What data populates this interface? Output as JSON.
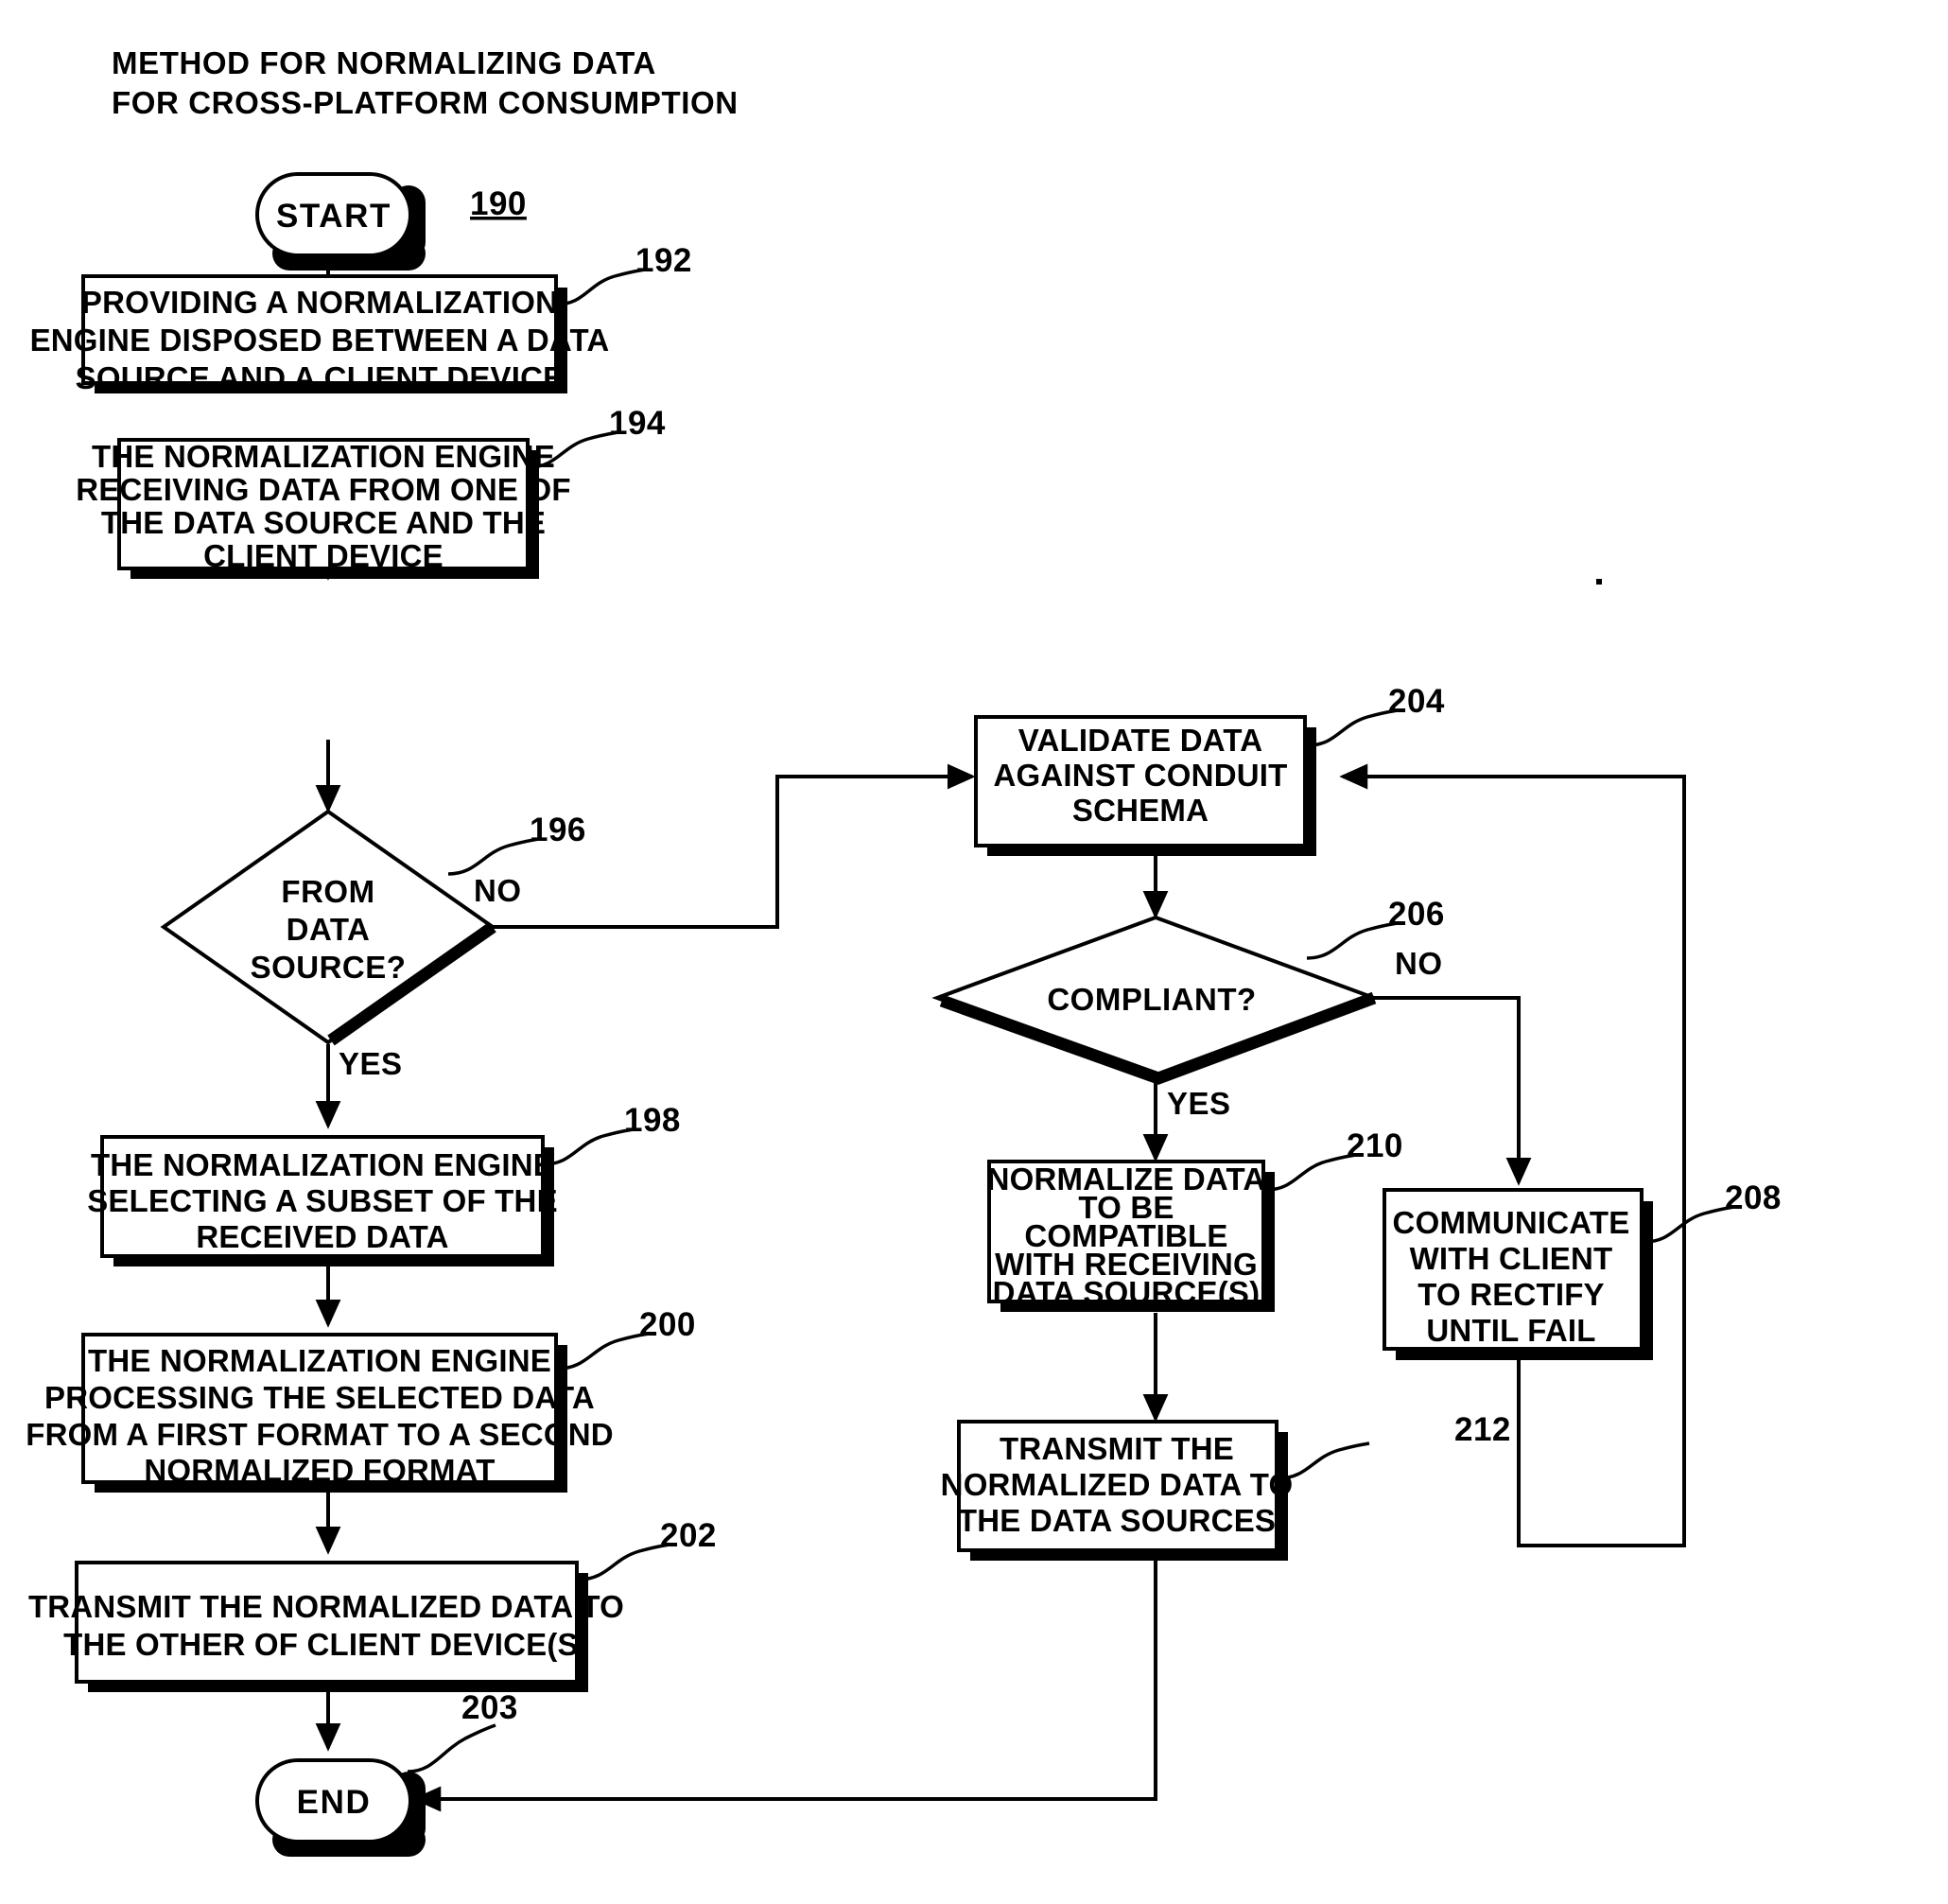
{
  "figure": {
    "title_line1": "METHOD FOR NORMALIZING DATA",
    "title_line2": "FOR CROSS-PLATFORM CONSUMPTION",
    "figure_ref": "190"
  },
  "terminals": {
    "start": "START",
    "end": "END",
    "end_ref": "203"
  },
  "nodes": {
    "n192": {
      "ref": "192",
      "lines": [
        "PROVIDING A NORMALIZATION",
        "ENGINE DISPOSED BETWEEN A DATA",
        "SOURCE AND A CLIENT DEVICE"
      ]
    },
    "n194": {
      "ref": "194",
      "lines": [
        "THE NORMALIZATION ENGINE",
        "RECEIVING DATA FROM ONE OF",
        "THE DATA SOURCE AND THE",
        "CLIENT DEVICE"
      ]
    },
    "n196": {
      "ref": "196",
      "lines": [
        "FROM",
        "DATA",
        "SOURCE?"
      ],
      "yes_label": "YES",
      "no_label": "NO"
    },
    "n198": {
      "ref": "198",
      "lines": [
        "THE NORMALIZATION ENGINE",
        "SELECTING A SUBSET OF THE",
        "RECEIVED DATA"
      ]
    },
    "n200": {
      "ref": "200",
      "lines": [
        "THE NORMALIZATION ENGINE",
        "PROCESSING THE SELECTED DATA",
        "FROM A FIRST FORMAT TO A SECOND",
        "NORMALIZED FORMAT"
      ]
    },
    "n202": {
      "ref": "202",
      "lines": [
        "TRANSMIT THE NORMALIZED DATA TO",
        "THE OTHER OF CLIENT DEVICE(S)"
      ]
    },
    "n204": {
      "ref": "204",
      "lines": [
        "VALIDATE DATA",
        "AGAINST CONDUIT",
        "SCHEMA"
      ]
    },
    "n206": {
      "ref": "206",
      "lines": [
        "COMPLIANT?"
      ],
      "yes_label": "YES",
      "no_label": "NO"
    },
    "n208": {
      "ref": "208",
      "lines": [
        "COMMUNICATE",
        "WITH CLIENT",
        "TO RECTIFY",
        "UNTIL FAIL"
      ]
    },
    "n210": {
      "ref": "210",
      "lines": [
        "NORMALIZE DATA",
        "TO BE",
        "COMPATIBLE",
        "WITH RECEIVING",
        "DATA SOURCE(S)"
      ]
    },
    "n212": {
      "ref": "212",
      "lines": [
        "TRANSMIT THE",
        "NORMALIZED DATA TO",
        "THE DATA SOURCES"
      ]
    }
  },
  "colors": {
    "ink": "#000000",
    "paper": "#ffffff"
  }
}
